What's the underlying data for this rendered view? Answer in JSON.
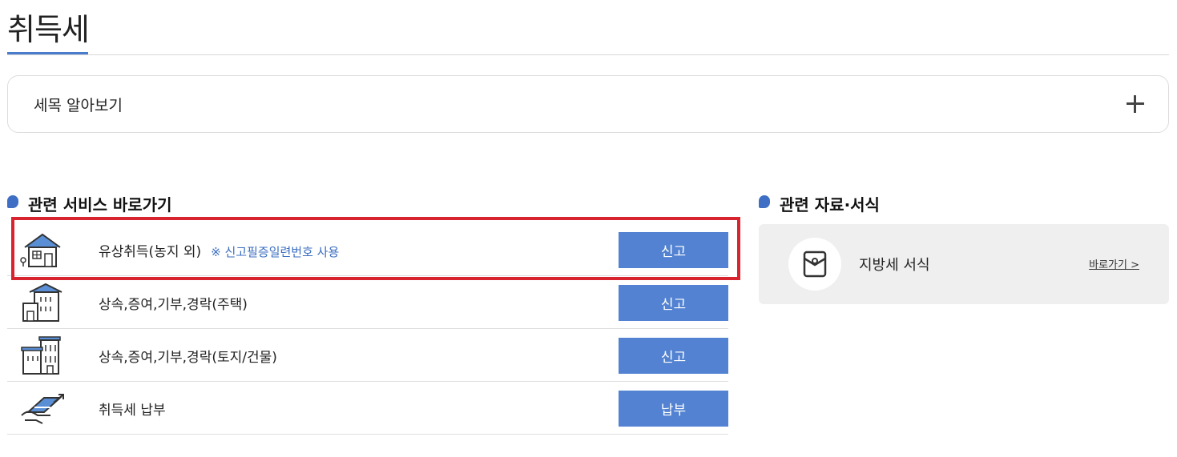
{
  "page": {
    "title": "취득세"
  },
  "accordion": {
    "label": "세목 알아보기"
  },
  "services": {
    "heading": "관련 서비스 바로가기",
    "items": [
      {
        "label": "유상취득(농지 외)",
        "note": "※ 신고필증일련번호 사용",
        "button": "신고",
        "icon": "house-icon"
      },
      {
        "label": "상속,증여,기부,경락(주택)",
        "note": "",
        "button": "신고",
        "icon": "apartment-icon"
      },
      {
        "label": "상속,증여,기부,경락(토지/건물)",
        "note": "",
        "button": "신고",
        "icon": "office-building-icon"
      },
      {
        "label": "취득세 납부",
        "note": "",
        "button": "납부",
        "icon": "card-payment-icon"
      }
    ]
  },
  "docs": {
    "heading": "관련 자료·서식",
    "item": {
      "label": "지방세 서식",
      "link": "바로가기 >",
      "icon": "envelope-icon"
    }
  },
  "colors": {
    "accent": "#4a7ccc",
    "button": "#5282d1",
    "highlight": "#d9232e",
    "note": "#3b6ec2"
  }
}
